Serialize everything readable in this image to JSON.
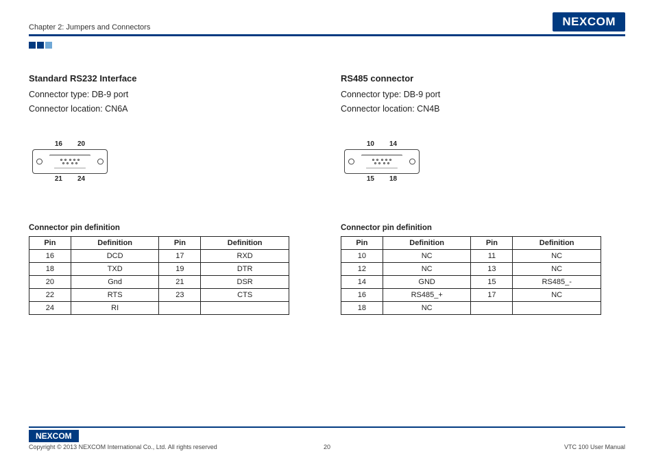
{
  "header": {
    "chapter": "Chapter 2: Jumpers and Connectors",
    "logo_text": "NEXCOM"
  },
  "left": {
    "title": "Standard RS232 Interface",
    "type": "Connector type: DB-9 port",
    "loc": "Connector location: CN6A",
    "diag": {
      "tl": "16",
      "tr": "20",
      "bl": "21",
      "br": "24"
    },
    "tbl_title": "Connector pin definition",
    "th": {
      "p1": "Pin",
      "d1": "Definition",
      "p2": "Pin",
      "d2": "Definition"
    },
    "rows": [
      {
        "p1": "16",
        "d1": "DCD",
        "p2": "17",
        "d2": "RXD"
      },
      {
        "p1": "18",
        "d1": "TXD",
        "p2": "19",
        "d2": "DTR"
      },
      {
        "p1": "20",
        "d1": "Gnd",
        "p2": "21",
        "d2": "DSR"
      },
      {
        "p1": "22",
        "d1": "RTS",
        "p2": "23",
        "d2": "CTS"
      },
      {
        "p1": "24",
        "d1": "RI",
        "p2": "",
        "d2": ""
      }
    ]
  },
  "right": {
    "title": "RS485 connector",
    "type": "Connector type: DB-9 port",
    "loc": "Connector location: CN4B",
    "diag": {
      "tl": "10",
      "tr": "14",
      "bl": "15",
      "br": "18"
    },
    "tbl_title": "Connector pin definition",
    "th": {
      "p1": "Pin",
      "d1": "Definition",
      "p2": "Pin",
      "d2": "Definition"
    },
    "rows": [
      {
        "p1": "10",
        "d1": "NC",
        "p2": "11",
        "d2": "NC"
      },
      {
        "p1": "12",
        "d1": "NC",
        "p2": "13",
        "d2": "NC"
      },
      {
        "p1": "14",
        "d1": "GND",
        "p2": "15",
        "d2": "RS485_-"
      },
      {
        "p1": "16",
        "d1": "RS485_+",
        "p2": "17",
        "d2": "NC"
      },
      {
        "p1": "18",
        "d1": "NC",
        "p2": "",
        "d2": ""
      }
    ]
  },
  "footer": {
    "copyright": "Copyright © 2013 NEXCOM International Co., Ltd. All rights reserved",
    "page": "20",
    "manual": "VTC 100 User Manual",
    "logo": "NEXCOM"
  }
}
